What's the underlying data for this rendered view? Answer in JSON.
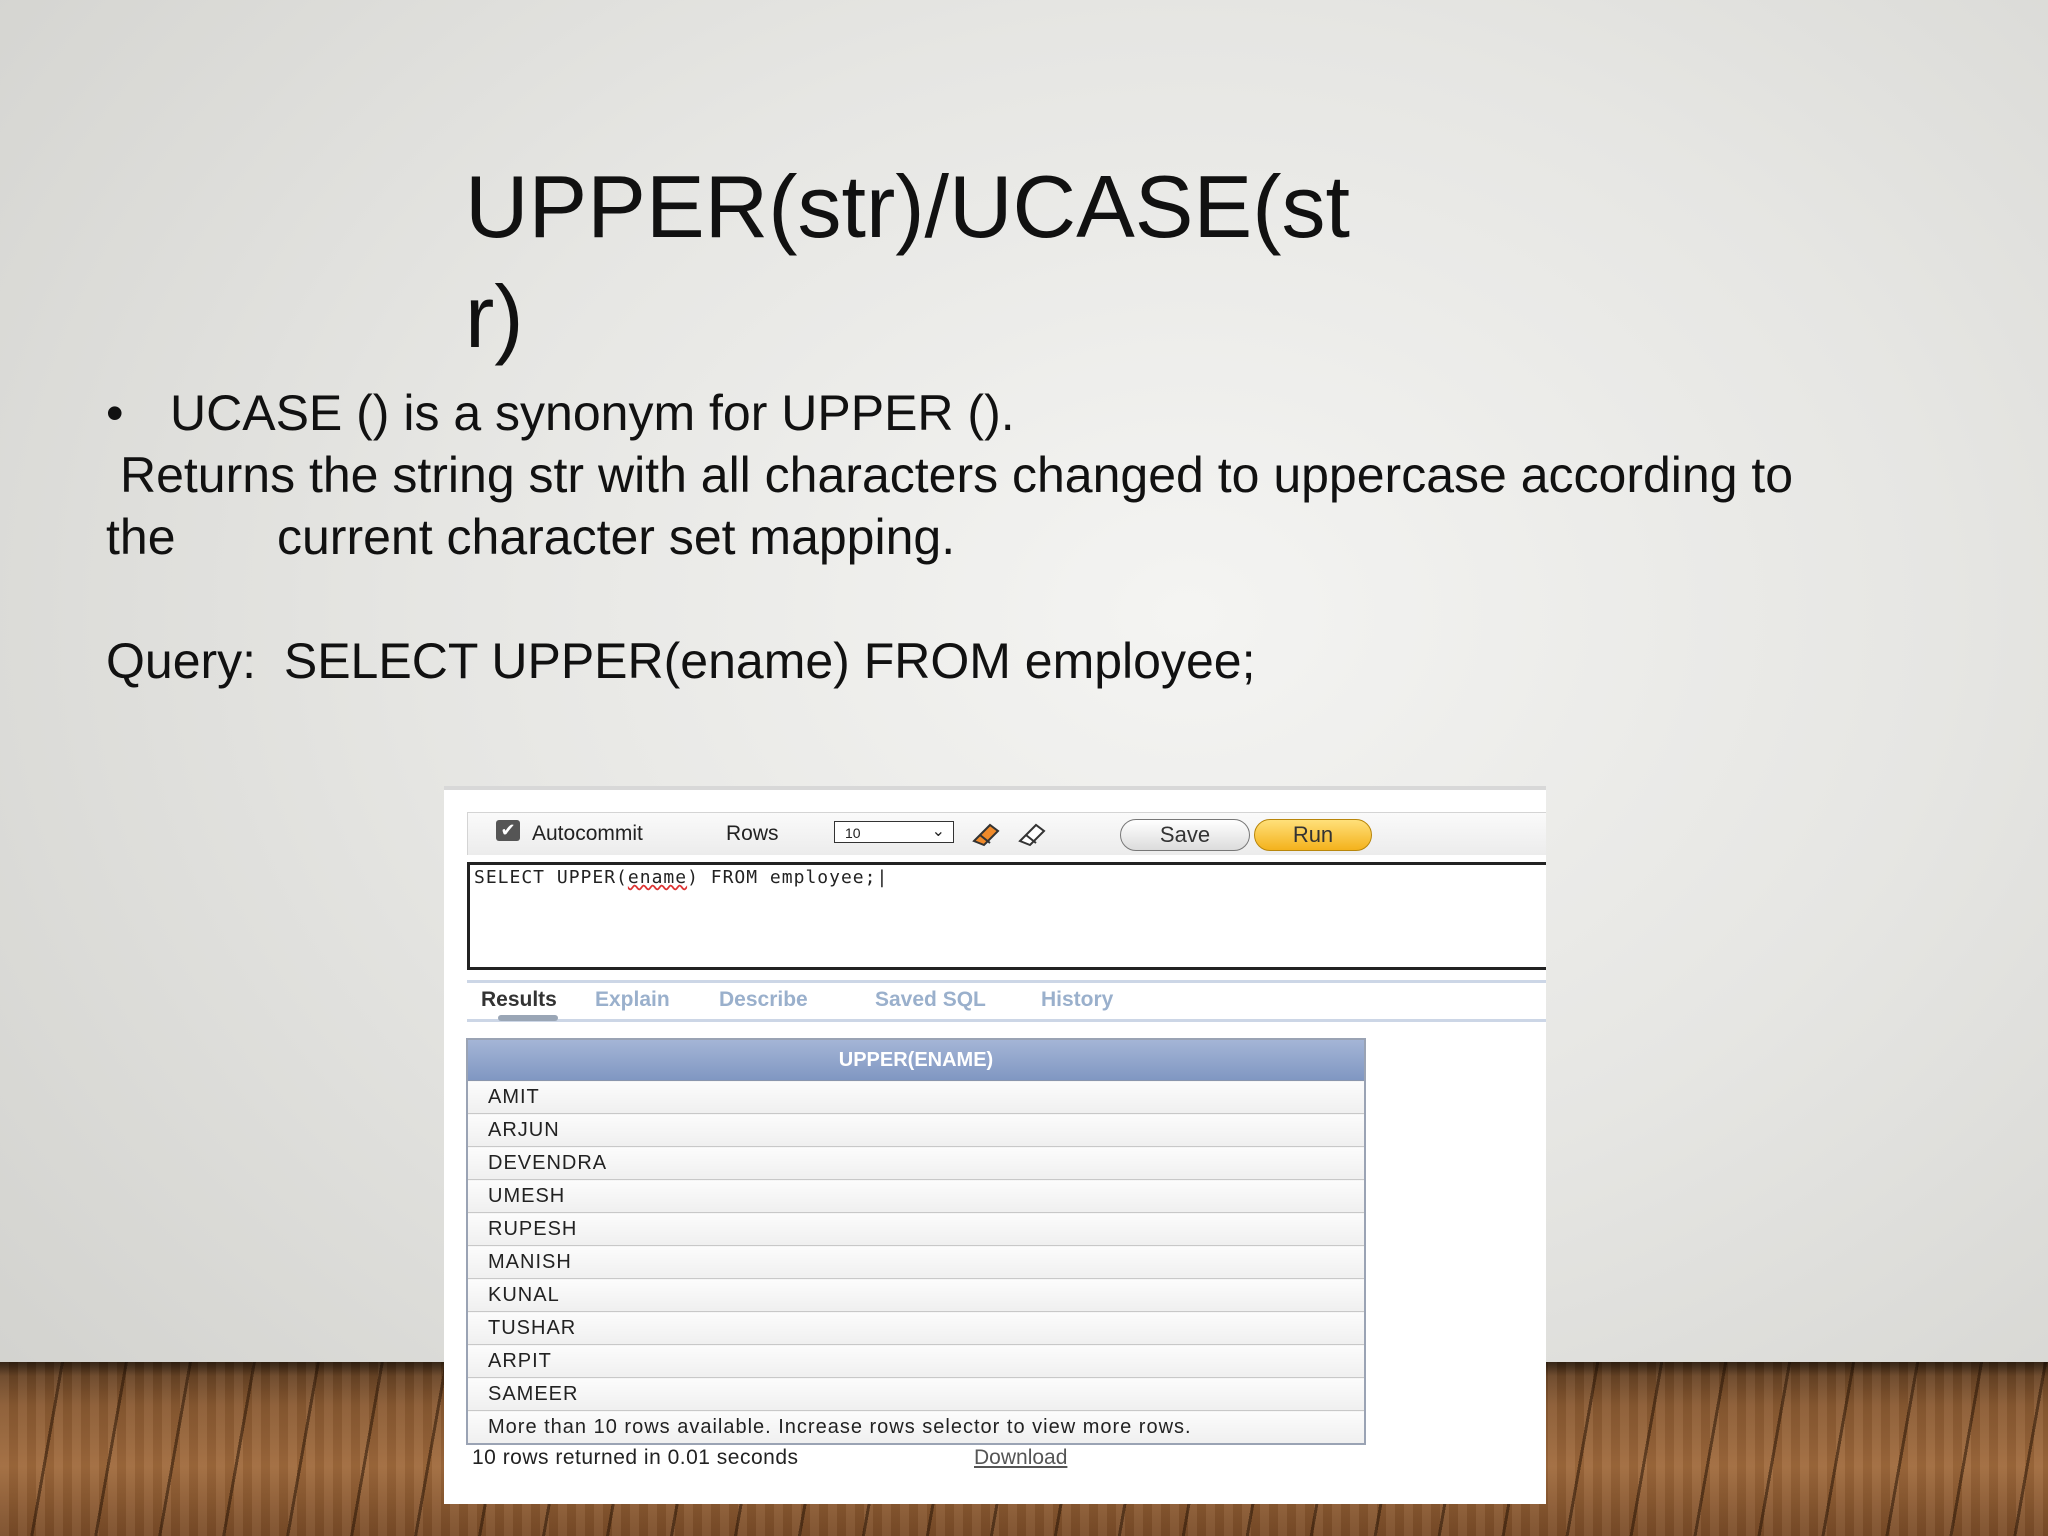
{
  "slide": {
    "title": "UPPER(str)/UCASE(str)",
    "bullet": "UCASE () is a synonym for UPPER ().",
    "bullet_marker": "•",
    "description_line1": "Returns the string str with all characters changed to uppercase according to",
    "description_line2_start": "the",
    "description_line2_rest": "current character set mapping.",
    "query_label": "Query:",
    "query_text": "SELECT UPPER(ename) FROM employee;"
  },
  "toolbar": {
    "autocommit_label": "Autocommit",
    "autocommit_checked": true,
    "rows_label": "Rows",
    "rows_value": "10",
    "eraser_icon": "eraser-icon",
    "clear_icon": "clear-icon",
    "save_label": "Save",
    "run_label": "Run"
  },
  "editor": {
    "sql_pre": "SELECT UPPER(",
    "sql_word": "ename",
    "sql_post": ") FROM employee;"
  },
  "tabs": [
    "Results",
    "Explain",
    "Describe",
    "Saved SQL",
    "History"
  ],
  "active_tab": "Results",
  "results": {
    "column": "UPPER(ENAME)",
    "rows": [
      "AMIT",
      "ARJUN",
      "DEVENDRA",
      "UMESH",
      "RUPESH",
      "MANISH",
      "KUNAL",
      "TUSHAR",
      "ARPIT",
      "SAMEER"
    ],
    "more_message": "More than 10 rows available. Increase rows selector to view more rows.",
    "summary": "10 rows returned in 0.01 seconds",
    "download_label": "Download"
  },
  "colors": {
    "run_button": "#f4b21c",
    "header_bg": "#8097c2",
    "tab_inactive": "#9ab0cc"
  }
}
